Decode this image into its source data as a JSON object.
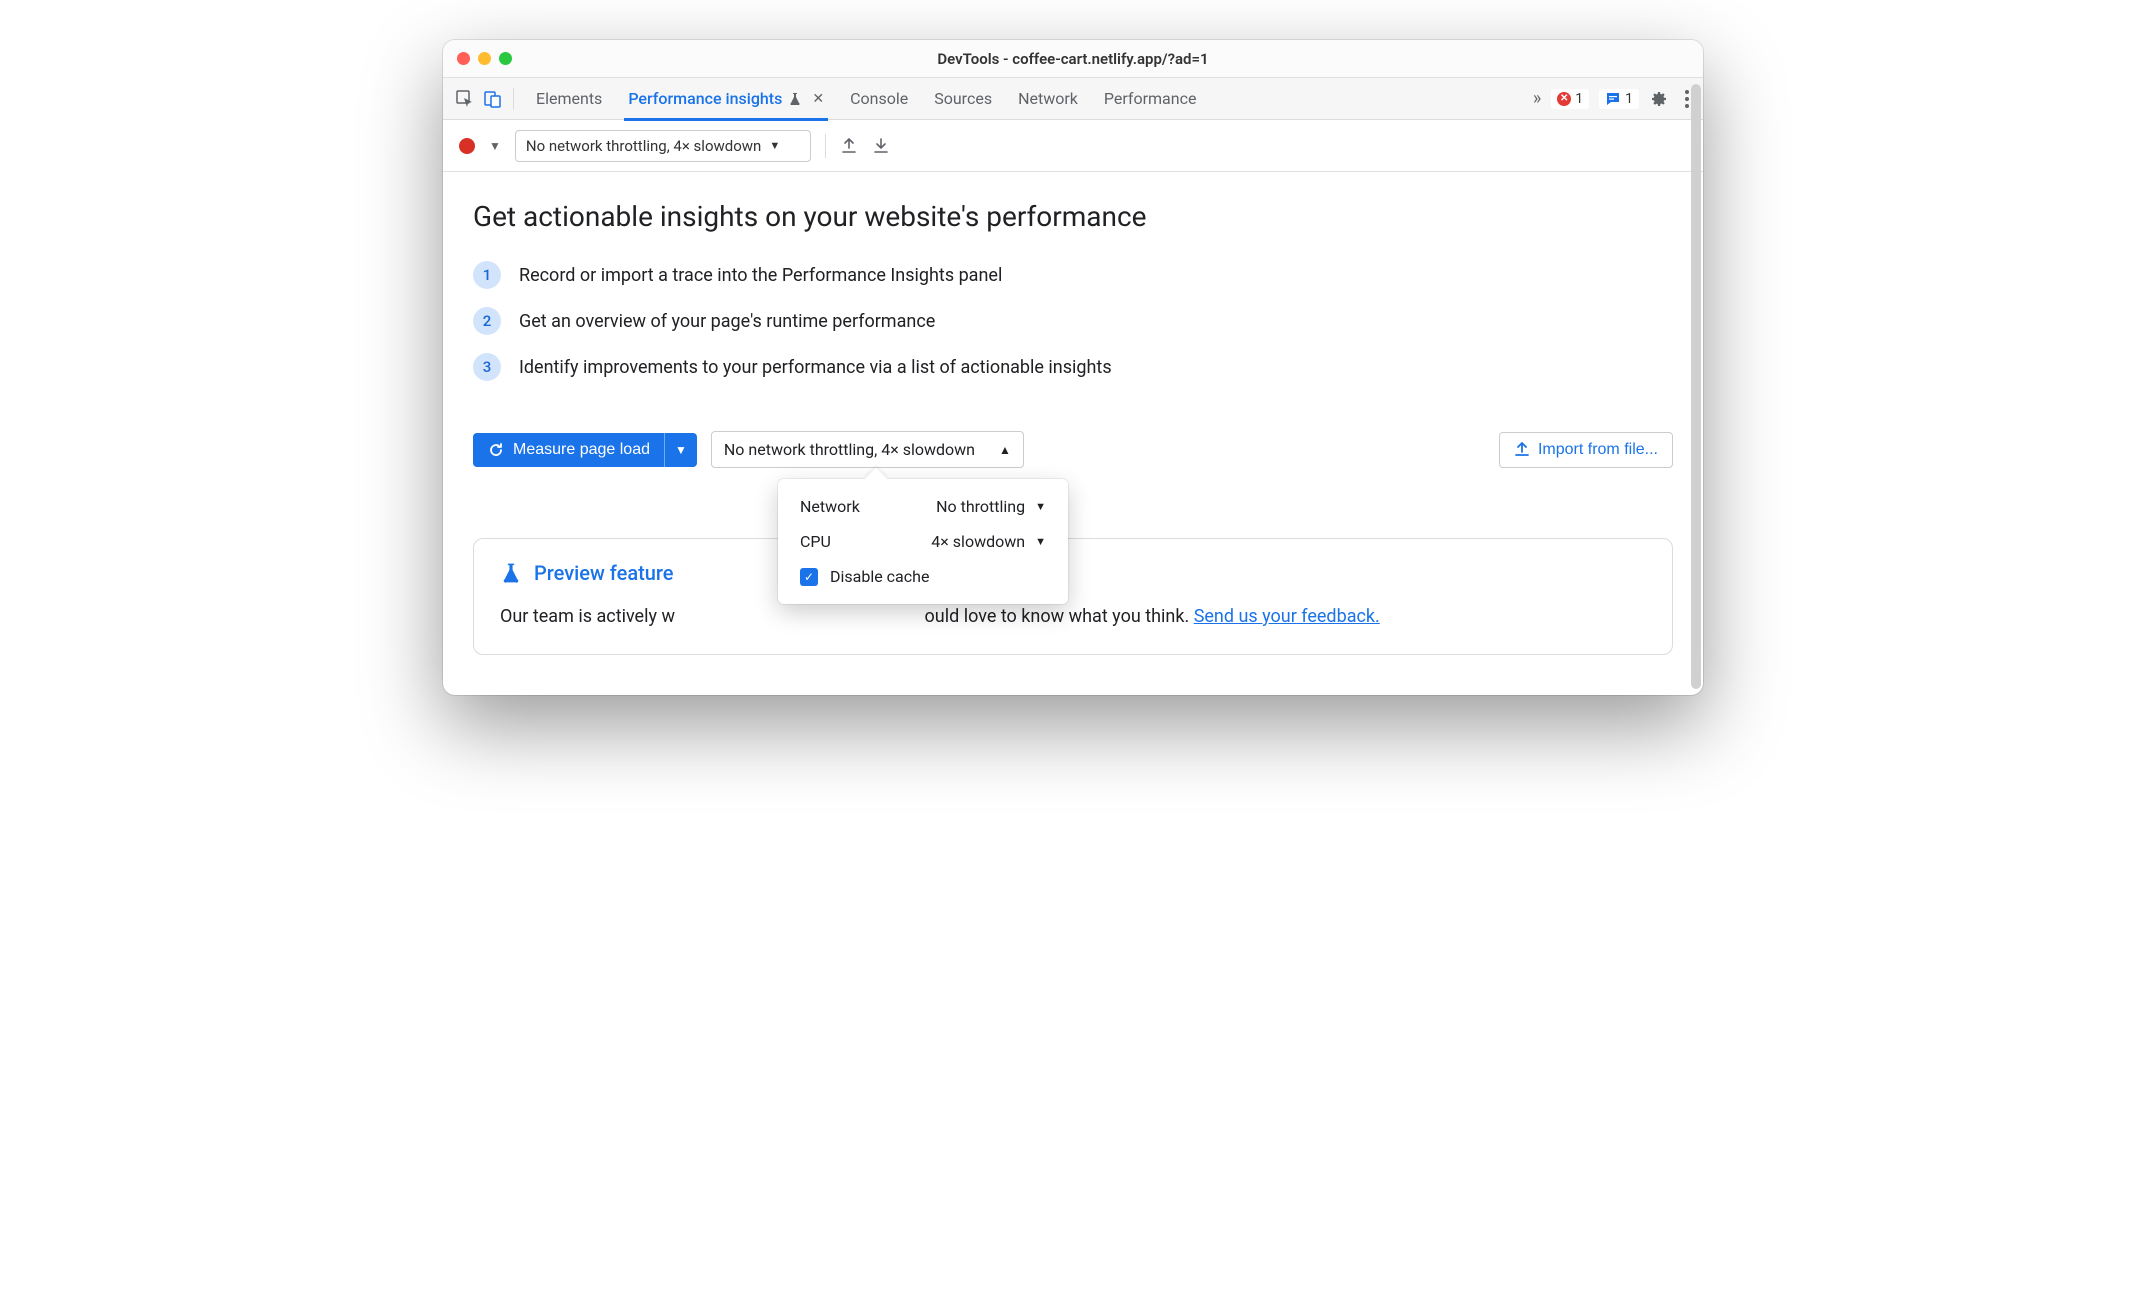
{
  "window": {
    "title": "DevTools - coffee-cart.netlify.app/?ad=1"
  },
  "tabs": {
    "elements": "Elements",
    "perf_insights": "Performance insights",
    "console": "Console",
    "sources": "Sources",
    "network": "Network",
    "performance": "Performance"
  },
  "badges": {
    "errors": "1",
    "messages": "1"
  },
  "toolbar": {
    "throttle_label": "No network throttling, 4× slowdown"
  },
  "headline": "Get actionable insights on your website's performance",
  "steps": [
    "Record or import a trace into the Performance Insights panel",
    "Get an overview of your page's runtime performance",
    "Identify improvements to your performance via a list of actionable insights"
  ],
  "actions": {
    "measure": "Measure page load",
    "throttle2": "No network throttling, 4× slowdown",
    "import": "Import from file..."
  },
  "popover": {
    "network_label": "Network",
    "network_value": "No throttling",
    "cpu_label": "CPU",
    "cpu_value": "4× slowdown",
    "disable_cache": "Disable cache"
  },
  "preview": {
    "title": "Preview feature",
    "text_before": "Our team is actively w",
    "text_after": "ould love to know what you think. ",
    "link": "Send us your feedback."
  }
}
